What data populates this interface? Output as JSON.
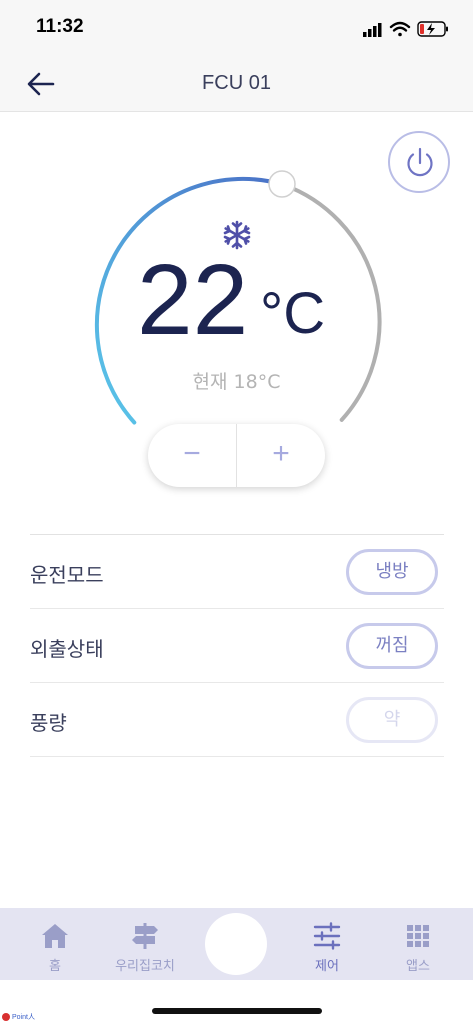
{
  "status_bar": {
    "time": "11:32"
  },
  "header": {
    "title": "FCU 01"
  },
  "thermostat": {
    "mode_icon": "snowflake-icon",
    "set_temperature": "22",
    "unit": "°C",
    "current_label": "현재 18°C",
    "minus_label": "−",
    "plus_label": "+",
    "colors": {
      "arc_cool_start": "#5ac8ea",
      "arc_cool_end": "#4a78c8",
      "arc_rest": "#b0b0b0",
      "temp_text": "#1c2450"
    }
  },
  "settings": [
    {
      "label": "운전모드",
      "value": "냉방",
      "enabled": true
    },
    {
      "label": "외출상태",
      "value": "꺼짐",
      "enabled": true
    },
    {
      "label": "풍량",
      "value": "약",
      "enabled": false
    }
  ],
  "tab_bar": {
    "tabs": [
      {
        "label": "홈",
        "icon": "home-icon"
      },
      {
        "label": "우리집코치",
        "icon": "signpost-icon"
      },
      {
        "label": "제어",
        "icon": "sliders-icon",
        "active": true
      },
      {
        "label": "앱스",
        "icon": "grid-icon"
      }
    ]
  },
  "watermark": {
    "text": "Point人"
  }
}
